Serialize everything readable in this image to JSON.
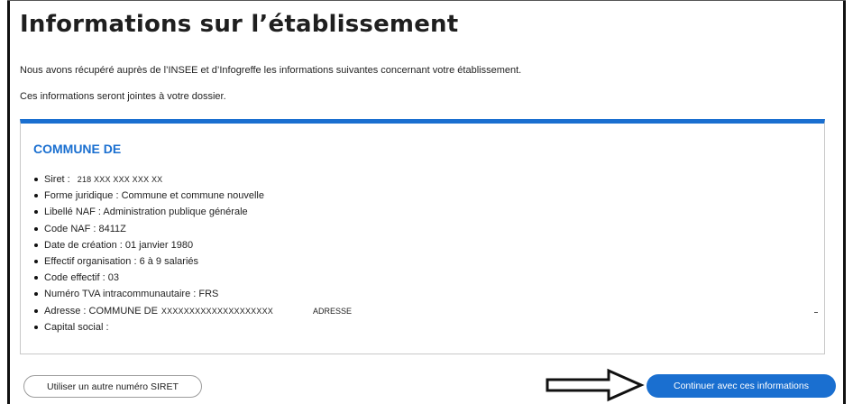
{
  "page": {
    "title": "Informations sur l’établissement",
    "intro_line_1": "Nous avons récupéré auprès de l’INSEE et d’Infogreffe les informations suivantes concernant votre établissement.",
    "intro_line_2": "Ces informations seront jointes à votre dossier."
  },
  "card": {
    "title": "COMMUNE DE",
    "items": {
      "siret_label": "Siret :",
      "siret_value": "218 XXX XXX XXX XX",
      "forme": "Forme juridique : Commune et commune nouvelle",
      "naf_label": "Libellé NAF : Administration publique générale",
      "naf_code": "Code NAF : 8411Z",
      "date_creation": "Date de création : 01 janvier 1980",
      "effectif_org": "Effectif organisation : 6 à 9 salariés",
      "code_effectif": "Code effectif : 03",
      "tva": "Numéro TVA intracommunautaire : FRS",
      "adresse_label": "Adresse : COMMUNE DE",
      "adresse_masked": "XXXXXXXXXXXXXXXXXXXX",
      "adresse_extra": "ADRESSE",
      "capital": "Capital social :"
    }
  },
  "buttons": {
    "other_siret": "Utiliser un autre numéro SIRET",
    "continue": "Continuer avec ces informations"
  },
  "icons": {
    "arrow": "right-arrow-icon"
  },
  "colors": {
    "accent": "#1a6fd0",
    "text": "#1e1e1e"
  }
}
